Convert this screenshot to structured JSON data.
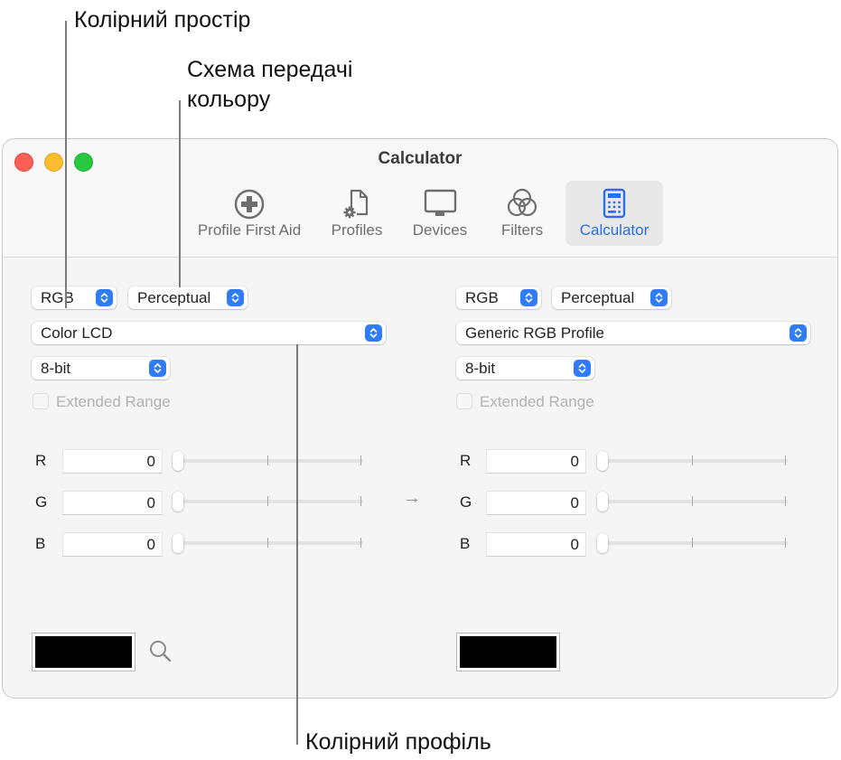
{
  "callouts": {
    "color_space": "Колірний простір",
    "rendering_intent_line1": "Схема передачі",
    "rendering_intent_line2": "кольору",
    "color_profile": "Колірний профіль"
  },
  "window": {
    "title": "Calculator",
    "toolbar": [
      {
        "label": "Profile First Aid",
        "icon": "plus-circle-icon",
        "active": false
      },
      {
        "label": "Profiles",
        "icon": "document-gear-icon",
        "active": false
      },
      {
        "label": "Devices",
        "icon": "display-icon",
        "active": false
      },
      {
        "label": "Filters",
        "icon": "overlapping-circles-icon",
        "active": false
      },
      {
        "label": "Calculator",
        "icon": "calculator-icon",
        "active": true
      }
    ],
    "accent_color": "#2f7cf6"
  },
  "left": {
    "color_space": "RGB",
    "intent": "Perceptual",
    "profile": "Color LCD",
    "depth": "8-bit",
    "extended_range_label": "Extended Range",
    "extended_range_checked": false,
    "channels": [
      {
        "label": "R",
        "value": "0",
        "slider_fraction": 0
      },
      {
        "label": "G",
        "value": "0",
        "slider_fraction": 0
      },
      {
        "label": "B",
        "value": "0",
        "slider_fraction": 0
      }
    ],
    "swatch_color": "#000000"
  },
  "arrow": "→",
  "right": {
    "color_space": "RGB",
    "intent": "Perceptual",
    "profile": "Generic RGB Profile",
    "depth": "8-bit",
    "extended_range_label": "Extended Range",
    "extended_range_checked": false,
    "channels": [
      {
        "label": "R",
        "value": "0",
        "slider_fraction": 0
      },
      {
        "label": "G",
        "value": "0",
        "slider_fraction": 0
      },
      {
        "label": "B",
        "value": "0",
        "slider_fraction": 0
      }
    ],
    "swatch_color": "#000000"
  }
}
